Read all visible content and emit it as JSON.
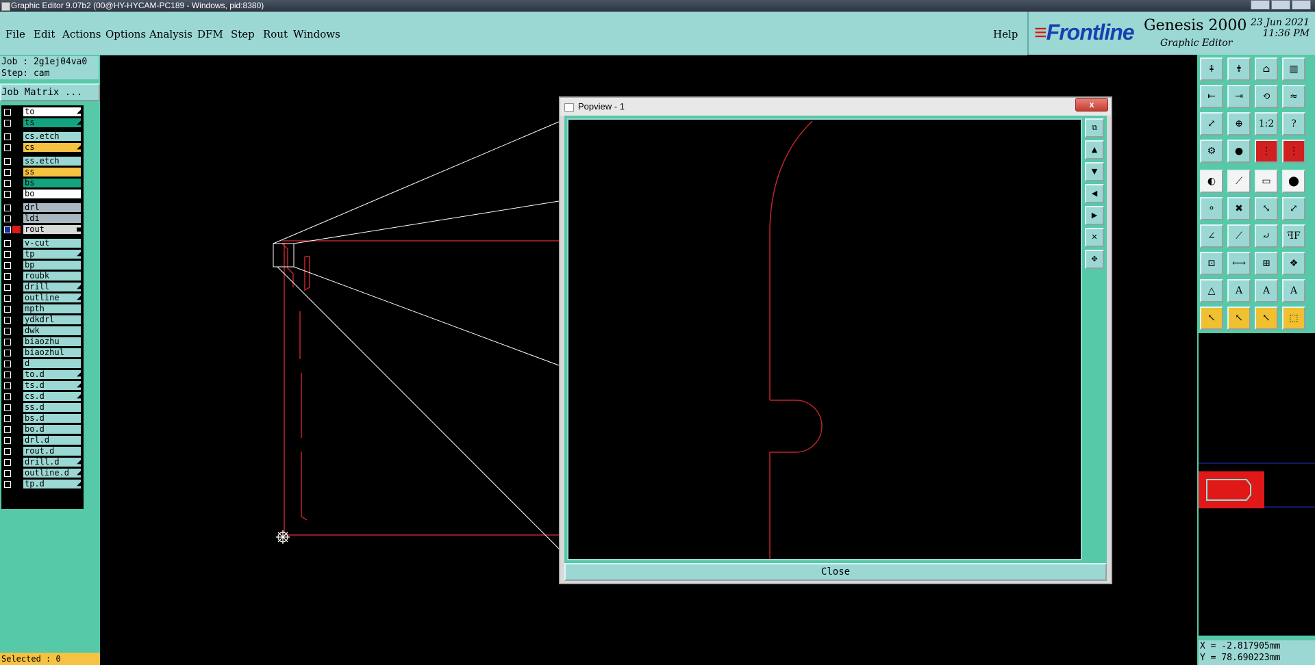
{
  "window": {
    "title": "Graphic Editor 9.07b2 (00@HY-HYCAM-PC189 - Windows, pid:8380)"
  },
  "menubar": {
    "items": [
      "File",
      "Edit",
      "Actions",
      "Options",
      "Analysis",
      "DFM",
      "Step",
      "Rout",
      "Windows"
    ],
    "help": "Help"
  },
  "brand": {
    "logo": "Frontline",
    "product": "Genesis 2000",
    "subtitle": "Graphic Editor",
    "date": "23 Jun 2021",
    "time": "11:36 PM"
  },
  "job": {
    "job_label": "Job : 2g1ej04va0",
    "step_label": "Step: cam",
    "matrix_button": "Job Matrix ..."
  },
  "layers": [
    {
      "name": "to",
      "color": "#ffffff",
      "mark": "◢"
    },
    {
      "name": "ts",
      "color": "#14a37f",
      "mark": "◢"
    },
    {
      "name": "cs.etch",
      "color": "#9bd8d4",
      "mark": ""
    },
    {
      "name": "cs",
      "color": "#f5c242",
      "mark": "◢"
    },
    {
      "name": "ss.etch",
      "color": "#9bd8d4",
      "mark": ""
    },
    {
      "name": "ss",
      "color": "#f5c242",
      "mark": ""
    },
    {
      "name": "bs",
      "color": "#14a37f",
      "mark": ""
    },
    {
      "name": "bo",
      "color": "#ffffff",
      "mark": ""
    },
    {
      "name": "drl",
      "color": "#a9b8c0",
      "mark": ""
    },
    {
      "name": "ldi",
      "color": "#a9b8c0",
      "mark": ""
    },
    {
      "name": "rout",
      "color": "#d9d9d9",
      "mark": "■",
      "active": true
    },
    {
      "name": "v-cut",
      "color": "#9bd8d4",
      "mark": ""
    },
    {
      "name": "tp",
      "color": "#9bd8d4",
      "mark": "◢"
    },
    {
      "name": "bp",
      "color": "#9bd8d4",
      "mark": ""
    },
    {
      "name": "roubk",
      "color": "#9bd8d4",
      "mark": ""
    },
    {
      "name": "drill",
      "color": "#9bd8d4",
      "mark": "◢"
    },
    {
      "name": "outline",
      "color": "#9bd8d4",
      "mark": "◢"
    },
    {
      "name": "mpth",
      "color": "#9bd8d4",
      "mark": ""
    },
    {
      "name": "ydkdrl",
      "color": "#9bd8d4",
      "mark": ""
    },
    {
      "name": "dwk",
      "color": "#9bd8d4",
      "mark": ""
    },
    {
      "name": "biaozhu",
      "color": "#9bd8d4",
      "mark": ""
    },
    {
      "name": "biaozhul",
      "color": "#9bd8d4",
      "mark": ""
    },
    {
      "name": "d",
      "color": "#9bd8d4",
      "mark": ""
    },
    {
      "name": "to.d",
      "color": "#9bd8d4",
      "mark": "◢"
    },
    {
      "name": "ts.d",
      "color": "#9bd8d4",
      "mark": "◢"
    },
    {
      "name": "cs.d",
      "color": "#9bd8d4",
      "mark": "◢"
    },
    {
      "name": "ss.d",
      "color": "#9bd8d4",
      "mark": ""
    },
    {
      "name": "bs.d",
      "color": "#9bd8d4",
      "mark": ""
    },
    {
      "name": "bo.d",
      "color": "#9bd8d4",
      "mark": ""
    },
    {
      "name": "drl.d",
      "color": "#9bd8d4",
      "mark": ""
    },
    {
      "name": "rout.d",
      "color": "#9bd8d4",
      "mark": ""
    },
    {
      "name": "drill.d",
      "color": "#9bd8d4",
      "mark": "◢"
    },
    {
      "name": "outline.d",
      "color": "#9bd8d4",
      "mark": "◢"
    },
    {
      "name": "tp.d",
      "color": "#9bd8d4",
      "mark": "◢"
    }
  ],
  "status": {
    "selected": "Selected : 0"
  },
  "coords": {
    "x": "X = -2.817905mm",
    "y": "Y = 78.690223mm"
  },
  "popview": {
    "title": "Popview - 1",
    "close_label": "Close",
    "close_x": "x"
  },
  "toolbox": {
    "icons": [
      "zoom-home-icon",
      "zoom-in-icon",
      "zoom-out-icon",
      "redraw-icon",
      "pan-icon",
      "snap-icon",
      "measure-icon",
      "undo-icon",
      "fit-icon",
      "zoom-area-icon",
      "scale-1-2-icon",
      "help-query-icon",
      "grid-icon",
      "pad-icon",
      "net-icon",
      "net-edit-icon",
      "pad-select-icon",
      "line-icon",
      "measure-ruler-icon",
      "circle-pad-icon",
      "node-icon",
      "cross-icon",
      "move-node-icon",
      "segment-icon",
      "angle-icon",
      "slash-icon",
      "arc-icon",
      "ff-text-icon",
      "pin-icon",
      "split-icon",
      "bracket-icon",
      "shapes-icon",
      "triangle-red-icon",
      "arrow-a-icon",
      "arrow-a2-icon",
      "arrow-a3-icon",
      "select-arrow-icon",
      "select-box-icon",
      "select-touch-icon",
      "select-net-icon"
    ]
  },
  "colors": {
    "teal_light": "#9bd8d4",
    "teal": "#55c9a8",
    "rout_red": "#c0262c",
    "warn_yellow": "#f5c242"
  }
}
